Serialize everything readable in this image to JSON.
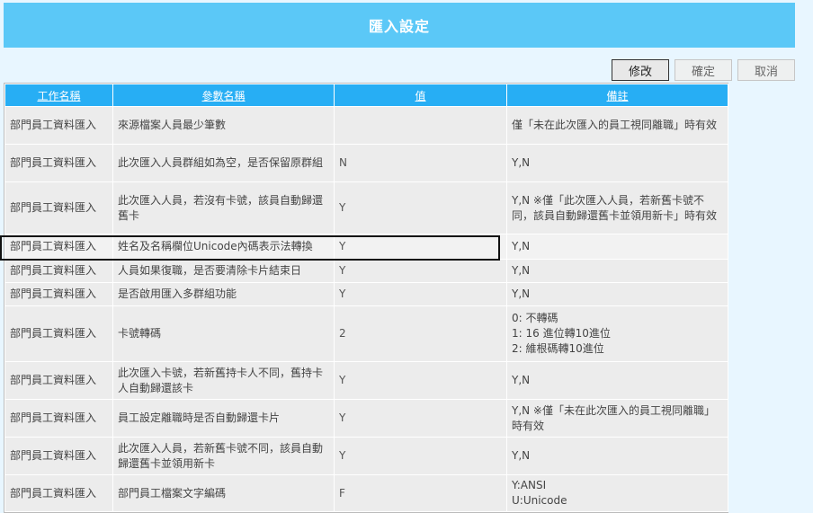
{
  "page": {
    "title": "匯入設定"
  },
  "toolbar": {
    "edit_label": "修改",
    "confirm_label": "確定",
    "cancel_label": "取消"
  },
  "table": {
    "headers": [
      "工作名稱",
      "參數名稱",
      "值",
      "備註"
    ],
    "rows": [
      {
        "task": "部門員工資料匯入",
        "param": "來源檔案人員最少筆數",
        "value": "",
        "note": "僅「未在此次匯入的員工視同離職」時有效"
      },
      {
        "task": "部門員工資料匯入",
        "param": "此次匯入人員群組如為空，是否保留原群組",
        "value": "N",
        "note": "Y,N"
      },
      {
        "task": "部門員工資料匯入",
        "param": "此次匯入人員，若沒有卡號，該員自動歸還舊卡",
        "value": "Y",
        "note": "Y,N ※僅「此次匯入人員，若新舊卡號不同，該員自動歸還舊卡並領用新卡」時有效"
      },
      {
        "task": "部門員工資料匯入",
        "param": "姓名及名稱欄位Unicode內碼表示法轉換",
        "value": "Y",
        "note": "Y,N"
      },
      {
        "task": "部門員工資料匯入",
        "param": "人員如果復職，是否要清除卡片結束日",
        "value": "Y",
        "note": "Y,N"
      },
      {
        "task": "部門員工資料匯入",
        "param": "是否啟用匯入多群組功能",
        "value": "Y",
        "note": "Y,N"
      },
      {
        "task": "部門員工資料匯入",
        "param": "卡號轉碼",
        "value": "2",
        "note": "0: 不轉碼\n1: 16 進位轉10進位\n2: 維根碼轉10進位"
      },
      {
        "task": "部門員工資料匯入",
        "param": "此次匯入卡號，若新舊持卡人不同，舊持卡人自動歸還該卡",
        "value": "Y",
        "note": "Y,N"
      },
      {
        "task": "部門員工資料匯入",
        "param": "員工設定離職時是否自動歸還卡片",
        "value": "Y",
        "note": "Y,N ※僅「未在此次匯入的員工視同離職」時有效"
      },
      {
        "task": "部門員工資料匯入",
        "param": "此次匯入人員，若新舊卡號不同，該員自動歸還舊卡並領用新卡",
        "value": "Y",
        "note": "Y,N"
      },
      {
        "task": "部門員工資料匯入",
        "param": "部門員工檔案文字編碼",
        "value": "F",
        "note": "Y:ANSI\nU:Unicode"
      }
    ]
  }
}
